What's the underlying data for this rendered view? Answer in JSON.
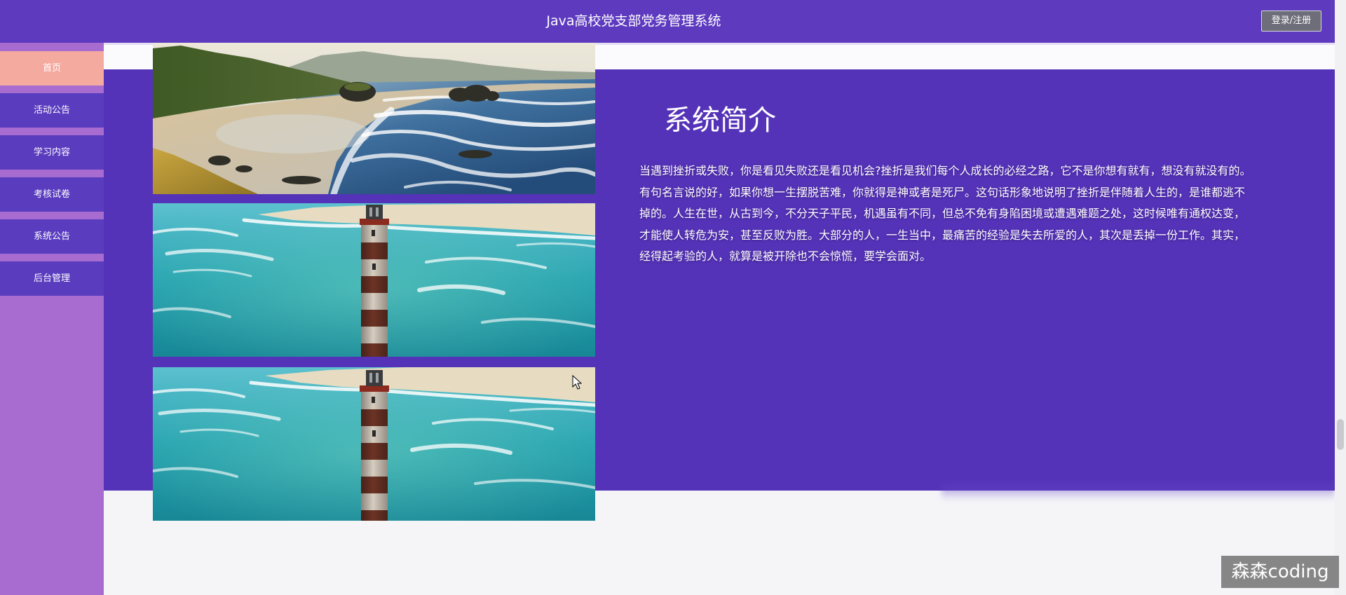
{
  "header": {
    "title": "Java高校党支部党务管理系统",
    "login_label": "登录/注册"
  },
  "sidebar": {
    "items": [
      {
        "label": "首页",
        "active": true
      },
      {
        "label": "活动公告",
        "active": false
      },
      {
        "label": "学习内容",
        "active": false
      },
      {
        "label": "考核试卷",
        "active": false
      },
      {
        "label": "系统公告",
        "active": false
      },
      {
        "label": "后台管理",
        "active": false
      }
    ]
  },
  "intro": {
    "title": "系统简介",
    "lines": [
      "当遇到挫折或失败，你是看见失败还是看见机会?挫折是我们每个人成长的必经之路，它不是你想有就有，想没有就没有的。",
      "有句名言说的好，如果你想一生摆脱苦难，你就得是神或者是死尸。这句话形象地说明了挫折是伴随着人生的，是谁都逃不",
      "掉的。人生在世，从古到今，不分天子平民，机遇虽有不同，但总不免有身陷困境或遭遇难题之处，这时候唯有通权达变，",
      "才能使人转危为安，甚至反败为胜。大部分的人，一生当中，最痛苦的经验是失去所爱的人，其次是丢掉一份工作。其实，",
      "经得起考验的人，就算是被开除也不会惊慌，要学会面对。"
    ]
  },
  "watermark": {
    "text": "森森coding"
  },
  "colors": {
    "header_bg": "#5e3abf",
    "sidebar_bg": "#a86bcf",
    "sidebar_item_bg": "#5a3cbf",
    "sidebar_active_bg": "#f4aa9f",
    "intro_panel_bg": "#5533b8",
    "page_bg": "#f5f5f8"
  }
}
